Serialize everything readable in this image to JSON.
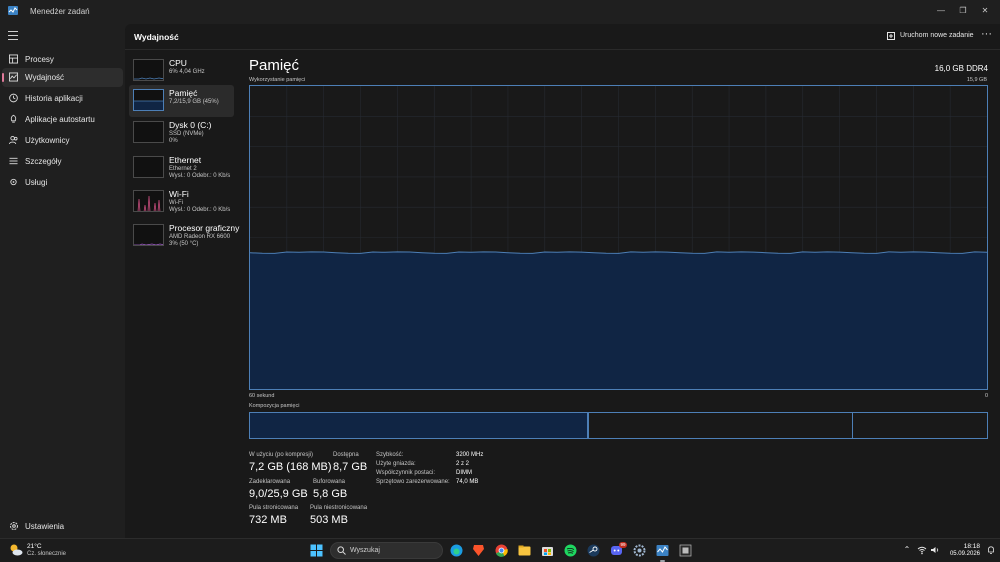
{
  "window": {
    "title": "Menedżer zadań"
  },
  "nav": {
    "items": [
      {
        "label": "Procesy",
        "icon": "grid-icon"
      },
      {
        "label": "Wydajność",
        "icon": "performance-icon",
        "active": true
      },
      {
        "label": "Historia aplikacji",
        "icon": "history-icon"
      },
      {
        "label": "Aplikacje autostartu",
        "icon": "startup-icon"
      },
      {
        "label": "Użytkownicy",
        "icon": "users-icon"
      },
      {
        "label": "Szczegóły",
        "icon": "details-icon"
      },
      {
        "label": "Usługi",
        "icon": "services-icon"
      }
    ],
    "settings_label": "Ustawienia"
  },
  "header": {
    "title": "Wydajność",
    "run_task_label": "Uruchom nowe zadanie",
    "more_label": "···"
  },
  "devices": [
    {
      "name": "CPU",
      "line2": "6% 4,04 GHz",
      "line3": ""
    },
    {
      "name": "Pamięć",
      "line2": "7,2/15,9 GB (45%)",
      "line3": "",
      "active": true
    },
    {
      "name": "Dysk 0 (C:)",
      "line2": "SSD (NVMe)",
      "line3": "0%"
    },
    {
      "name": "Ethernet",
      "line2": "Ethernet 2",
      "line3": "Wysł.: 0 Odebr.: 0 Kb/s"
    },
    {
      "name": "Wi-Fi",
      "line2": "Wi-Fi",
      "line3": "Wysł.: 0 Odebr.: 0 Kb/s"
    },
    {
      "name": "Procesor graficzny",
      "line2": "AMD Radeon RX 6600",
      "line3": "3% (50 °C)"
    }
  ],
  "memory": {
    "title": "Pamięć",
    "total": "16,0 GB DDR4",
    "usage_label": "Wykorzystanie pamięci",
    "usage_max": "15,9 GB",
    "axis_left": "60 sekund",
    "axis_right": "0",
    "composition_label": "Kompozycja pamięci",
    "in_use_fraction": 0.45,
    "stats": {
      "in_use_label": "W użyciu (po kompresji)",
      "in_use_value": "7,2 GB (168 MB)",
      "available_label": "Dostępna",
      "available_value": "8,7 GB",
      "committed_label": "Zadeklarowana",
      "committed_value": "9,0/25,9 GB",
      "cached_label": "Buforowana",
      "cached_value": "5,8 GB",
      "paged_label": "Pula stronicowana",
      "paged_value": "732 MB",
      "nonpaged_label": "Pula niestronicowana",
      "nonpaged_value": "503 MB"
    },
    "specs": [
      {
        "key": "Szybkość:",
        "value": "3200 MHz"
      },
      {
        "key": "Użyte gniazda:",
        "value": "2 z 2"
      },
      {
        "key": "Współczynnik postaci:",
        "value": "DIMM"
      },
      {
        "key": "Sprzętowo zarezerwowane:",
        "value": "74,0 MB"
      }
    ]
  },
  "taskbar": {
    "weather_temp": "21°C",
    "weather_desc": "Cz. słonecznie",
    "search_placeholder": "Wyszukaj",
    "time": "18:18",
    "date": "05.09.2026",
    "badge": "99"
  },
  "colors": {
    "accent": "#e07a9a",
    "graph_border": "#4d7fb6",
    "graph_fill": "#102544"
  }
}
